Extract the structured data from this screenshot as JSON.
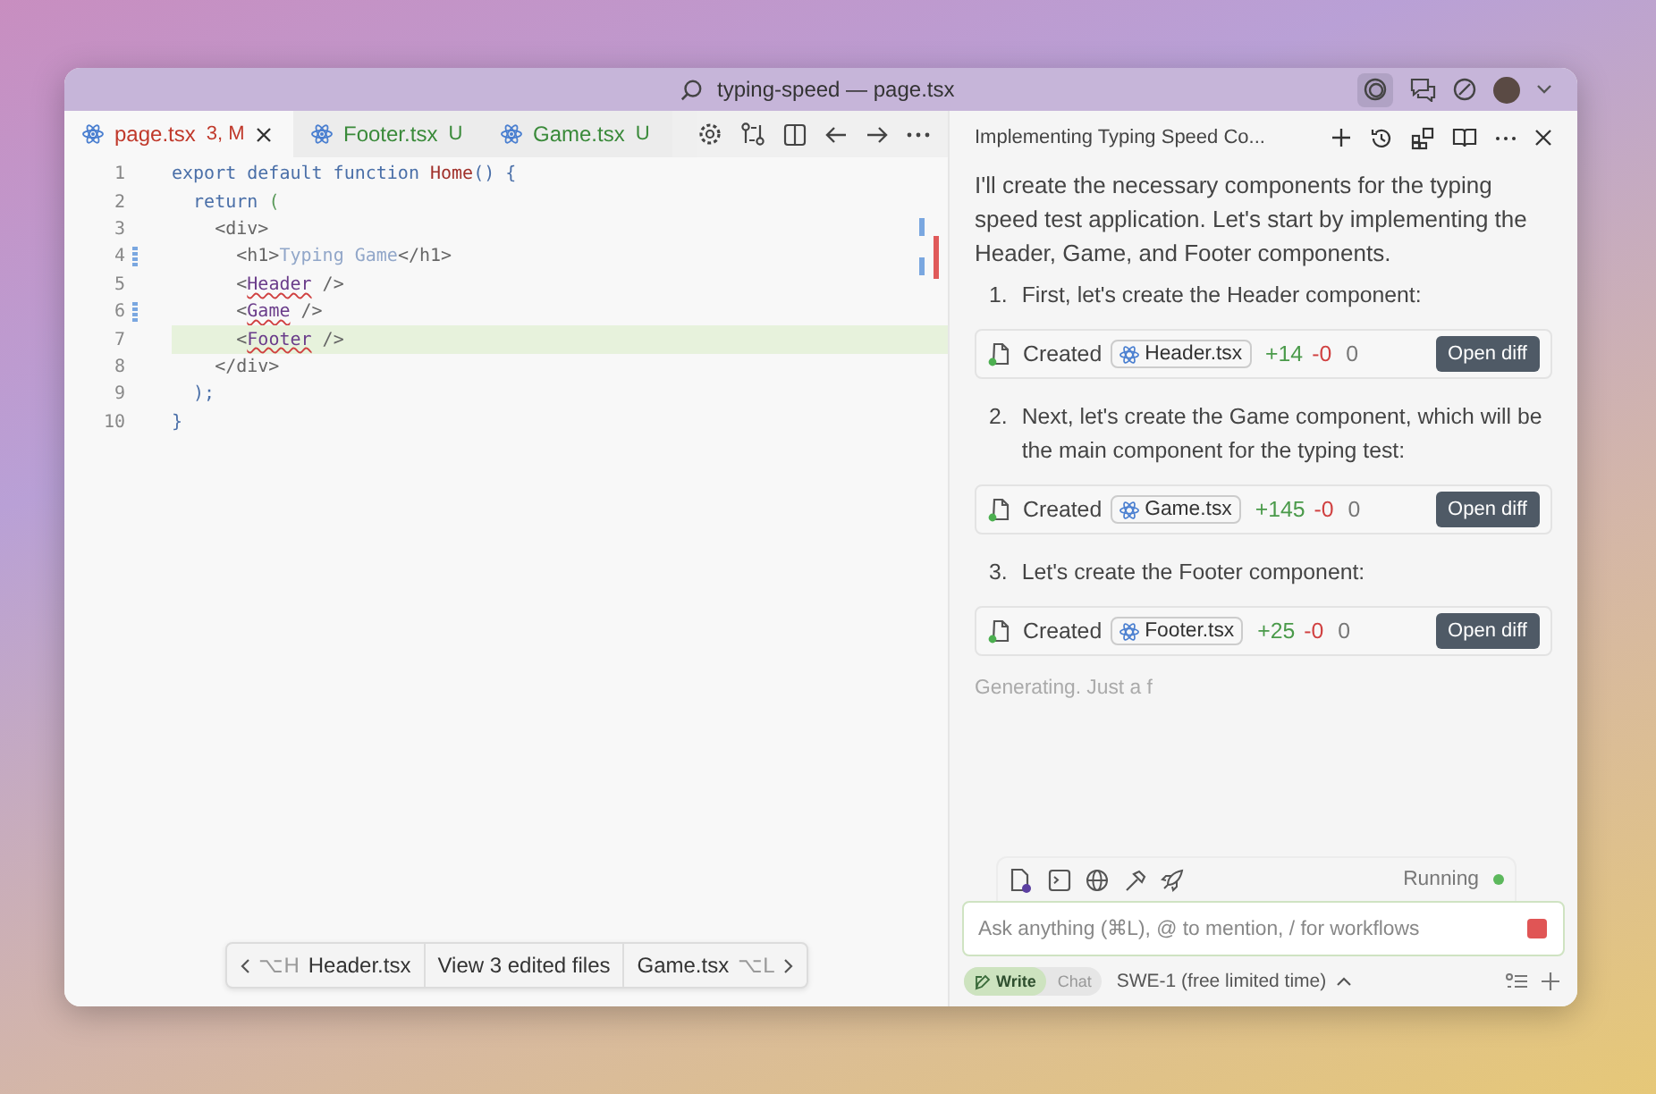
{
  "window": {
    "title": "typing-speed — page.tsx"
  },
  "editor": {
    "tabs": [
      {
        "label": "page.tsx",
        "status": "3, M",
        "kind": "error",
        "selected": true,
        "closable": true
      },
      {
        "label": "Footer.tsx",
        "status": "U",
        "kind": "untracked",
        "selected": false,
        "closable": false
      },
      {
        "label": "Game.tsx",
        "status": "U",
        "kind": "untracked",
        "selected": false,
        "closable": false
      }
    ],
    "lines": [
      {
        "number": "1",
        "modified": false,
        "highlighted": false,
        "tokens": [
          {
            "text": "export default function ",
            "kind": "keyword"
          },
          {
            "text": "Home",
            "kind": "function"
          },
          {
            "text": "() {",
            "kind": "punct"
          }
        ]
      },
      {
        "number": "2",
        "modified": false,
        "highlighted": false,
        "tokens": [
          {
            "text": "  return ",
            "kind": "keyword"
          },
          {
            "text": "(",
            "kind": "paren"
          }
        ]
      },
      {
        "number": "3",
        "modified": false,
        "highlighted": false,
        "tokens": [
          {
            "text": "    <div>",
            "kind": "tag"
          }
        ]
      },
      {
        "number": "4",
        "modified": true,
        "highlighted": false,
        "tokens": [
          {
            "text": "      <h1>",
            "kind": "tag"
          },
          {
            "text": "Typing Game",
            "kind": "string"
          },
          {
            "text": "</h1>",
            "kind": "tag"
          }
        ]
      },
      {
        "number": "5",
        "modified": false,
        "highlighted": false,
        "tokens": [
          {
            "text": "      <",
            "kind": "tag"
          },
          {
            "text": "Header",
            "kind": "component"
          },
          {
            "text": " />",
            "kind": "tag"
          }
        ]
      },
      {
        "number": "6",
        "modified": true,
        "highlighted": false,
        "tokens": [
          {
            "text": "      <",
            "kind": "tag"
          },
          {
            "text": "Game",
            "kind": "component"
          },
          {
            "text": " />",
            "kind": "tag"
          }
        ]
      },
      {
        "number": "7",
        "modified": false,
        "highlighted": true,
        "tokens": [
          {
            "text": "      <",
            "kind": "tag"
          },
          {
            "text": "Footer",
            "kind": "component"
          },
          {
            "text": " />",
            "kind": "tag"
          }
        ]
      },
      {
        "number": "8",
        "modified": false,
        "highlighted": false,
        "tokens": [
          {
            "text": "    </div>",
            "kind": "tag"
          }
        ]
      },
      {
        "number": "9",
        "modified": false,
        "highlighted": false,
        "tokens": [
          {
            "text": "  );",
            "kind": "punct"
          }
        ]
      },
      {
        "number": "10",
        "modified": false,
        "highlighted": false,
        "tokens": [
          {
            "text": "}",
            "kind": "punct"
          }
        ]
      }
    ],
    "file_nav": {
      "previous": {
        "shortcut": "⌥H",
        "label": "Header.tsx"
      },
      "middle": "View 3 edited files",
      "next": {
        "label": "Game.tsx",
        "shortcut": "⌥L"
      }
    }
  },
  "chat": {
    "title": "Implementing Typing Speed Co...",
    "intro": "I'll create the necessary components for the typing speed test application. Let's start by implementing the Header, Game, and Footer components.",
    "steps": [
      {
        "number": "1.",
        "text": "First, let's create the Header component:",
        "file": {
          "action": "Created",
          "name": "Header.tsx",
          "added": "+14",
          "removed": "-0",
          "count": "0",
          "button": "Open diff"
        }
      },
      {
        "number": "2.",
        "text": "Next, let's create the Game component, which will be the main component for the typing test:",
        "file": {
          "action": "Created",
          "name": "Game.tsx",
          "added": "+145",
          "removed": "-0",
          "count": "0",
          "button": "Open diff"
        }
      },
      {
        "number": "3.",
        "text": "Let's create the Footer component:",
        "file": {
          "action": "Created",
          "name": "Footer.tsx",
          "added": "+25",
          "removed": "-0",
          "count": "0",
          "button": "Open diff"
        }
      }
    ],
    "generating": "Generating. Just a f",
    "status": "Running",
    "input": {
      "placeholder": "Ask anything (⌘L), @ to mention, / for workflows"
    },
    "modes": [
      {
        "label": "Write",
        "selected": true
      },
      {
        "label": "Chat",
        "selected": false
      }
    ],
    "model": "SWE-1 (free limited time)"
  }
}
